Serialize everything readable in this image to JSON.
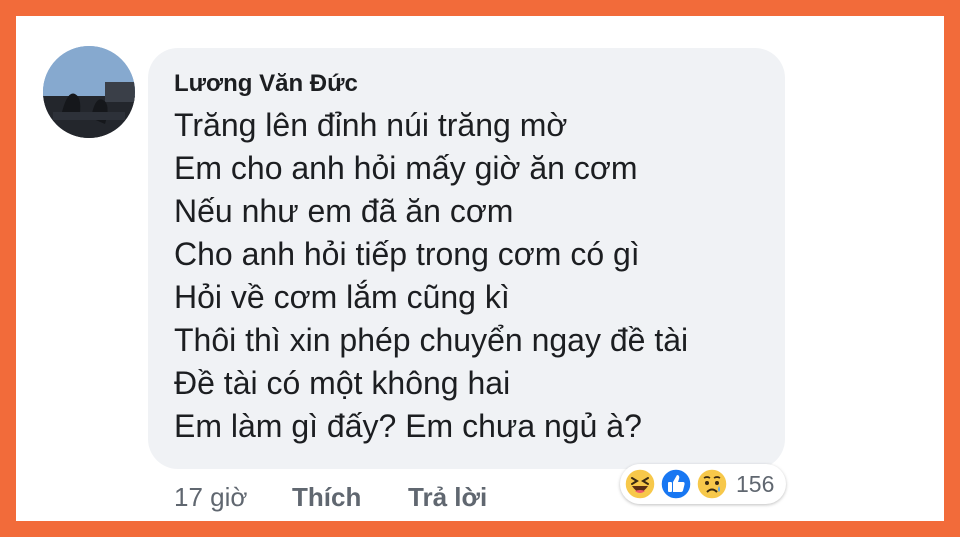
{
  "comment": {
    "author": "Lương Văn Đức",
    "lines": [
      "Trăng lên đỉnh núi trăng mờ",
      "Em cho anh hỏi mấy giờ ăn cơm",
      "Nếu như em đã ăn cơm",
      "Cho anh hỏi tiếp trong cơm có gì",
      "Hỏi về cơm lắm cũng kì",
      "Thôi thì xin phép chuyển ngay đề tài",
      "Đề tài có một không hai",
      "Em làm gì đấy? Em chưa ngủ à?"
    ],
    "time": "17 giờ",
    "like_label": "Thích",
    "reply_label": "Trả lời",
    "reactions": {
      "icons": [
        "haha-emoji-icon",
        "like-thumb-icon",
        "sad-emoji-icon"
      ],
      "count": "156"
    }
  },
  "colors": {
    "border": "#f26b3a",
    "bubble": "#f0f2f5",
    "like_blue": "#1877f2",
    "emoji_yellow": "#f7c84a"
  }
}
